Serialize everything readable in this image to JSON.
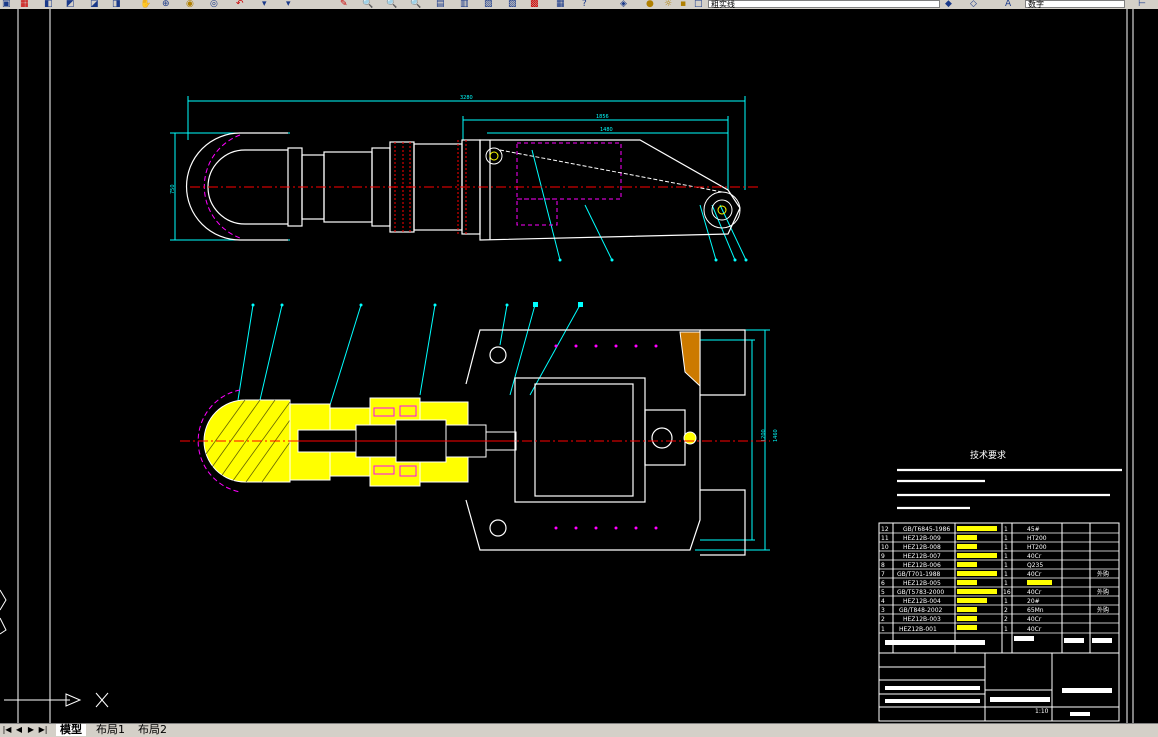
{
  "toolbar": {
    "layer_name": "粗实线",
    "style_name": "数字"
  },
  "tabs": [
    {
      "label": "模型"
    },
    {
      "label": "布局1"
    },
    {
      "label": "布局2"
    }
  ],
  "technical_requirements": {
    "title": "技术要求"
  },
  "bom": {
    "rows": [
      {
        "no": "12",
        "code": "GB/T6845-1986",
        "qty": "1",
        "mat": "45#",
        "note": ""
      },
      {
        "no": "11",
        "code": "HEZ12B-009",
        "qty": "1",
        "mat": "HT200",
        "note": ""
      },
      {
        "no": "10",
        "code": "HEZ12B-008",
        "qty": "1",
        "mat": "HT200",
        "note": ""
      },
      {
        "no": "9",
        "code": "HEZ12B-007",
        "qty": "1",
        "mat": "40Cr",
        "note": ""
      },
      {
        "no": "8",
        "code": "HEZ12B-006",
        "qty": "1",
        "mat": "Q235",
        "note": ""
      },
      {
        "no": "7",
        "code": "GB/T701-1988",
        "qty": "1",
        "mat": "40Cr",
        "note": "外购"
      },
      {
        "no": "6",
        "code": "HEZ12B-005",
        "qty": "1",
        "mat": "",
        "note": ""
      },
      {
        "no": "5",
        "code": "GB/T5783-2000",
        "qty": "16",
        "mat": "40Cr",
        "note": "外购"
      },
      {
        "no": "4",
        "code": "HEZ12B-004",
        "qty": "1",
        "mat": "20#",
        "note": ""
      },
      {
        "no": "3",
        "code": "GB/T848-2002",
        "qty": "2",
        "mat": "65Mn",
        "note": "外购"
      },
      {
        "no": "2",
        "code": "HEZ12B-003",
        "qty": "2",
        "mat": "40Cr",
        "note": ""
      },
      {
        "no": "1",
        "code": "HEZ12B-001",
        "qty": "1",
        "mat": "40Cr",
        "note": ""
      }
    ],
    "scale": "1:10"
  },
  "dimensions": {
    "overall": "3280",
    "upper_a": "1856",
    "upper_b": "1480",
    "left_height": "750",
    "right_a": "1200",
    "right_b": "1460"
  }
}
